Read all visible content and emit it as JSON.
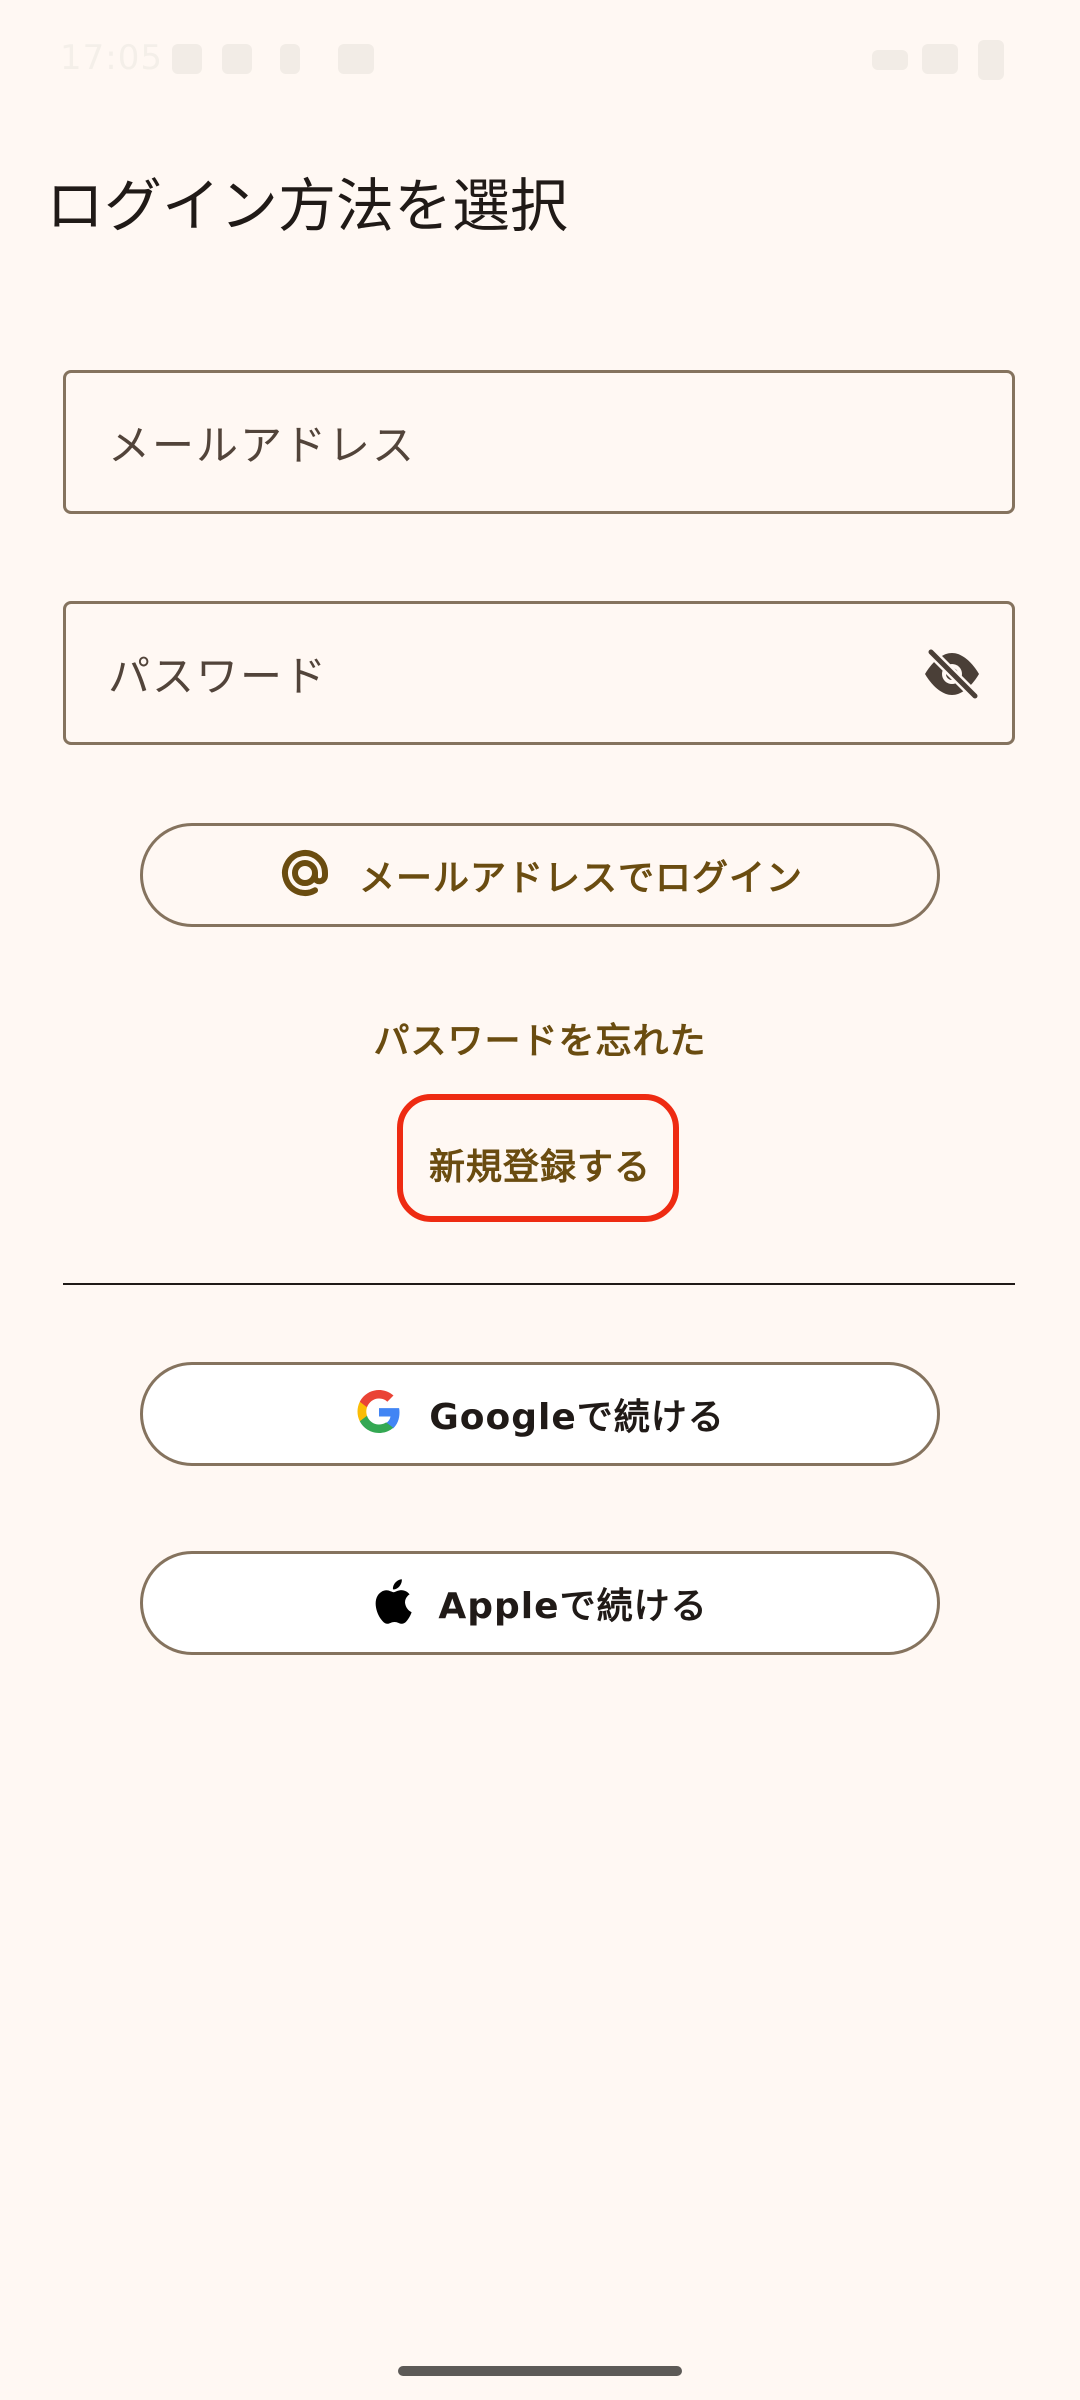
{
  "status_bar": {
    "time": "17:05"
  },
  "page": {
    "title": "ログイン方法を選択"
  },
  "form": {
    "email_placeholder": "メールアドレス",
    "password_placeholder": "パスワード",
    "password_visibility_icon": "visibility-off-icon"
  },
  "actions": {
    "email_login_label": "メールアドレスでログイン",
    "email_login_icon": "at-sign-icon",
    "forgot_password_label": "パスワードを忘れた",
    "register_label": "新規登録する",
    "google_label": "Googleで続ける",
    "google_icon": "google-icon",
    "apple_label": "Appleで続ける",
    "apple_icon": "apple-icon"
  },
  "colors": {
    "background": "#fff8f3",
    "primary": "#6a4c10",
    "outline": "#85735e",
    "highlight": "#ee2b12"
  }
}
